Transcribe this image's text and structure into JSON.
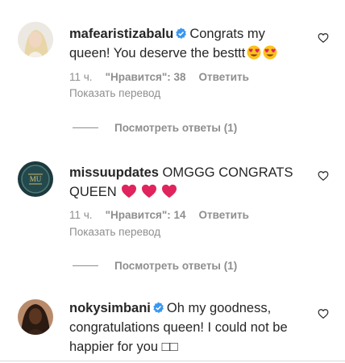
{
  "comments": [
    {
      "username": "mafearistizabalu",
      "verified": true,
      "text": "Congrats my queen! You deserve the besttt",
      "time": "11 ч.",
      "likes": "\"Нравится\": 38",
      "reply": "Ответить",
      "translate": "Показать перевод",
      "view_replies": "Посмотреть ответы (1)",
      "emoji": [
        "heart-eyes-emoji",
        "heart-eyes-emoji"
      ]
    },
    {
      "username": "missuupdates",
      "verified": false,
      "text": "OMGGG CONGRATS QUEEN",
      "time": "11 ч.",
      "likes": "\"Нравится\": 14",
      "reply": "Ответить",
      "translate": "Показать перевод",
      "view_replies": "Посмотреть ответы (1)",
      "emoji": [
        "red-heart-emoji",
        "red-heart-emoji",
        "red-heart-emoji"
      ]
    },
    {
      "username": "nokysimbani",
      "verified": true,
      "text": "Oh my goodness, congratulations queen! I could not be happier for you",
      "trailing_glyphs": "□□"
    }
  ],
  "colors": {
    "verified_blue": "#3897f0",
    "secondary_text": "#8e8e8e",
    "primary_text": "#262626",
    "heart_red": "#e0245e"
  }
}
